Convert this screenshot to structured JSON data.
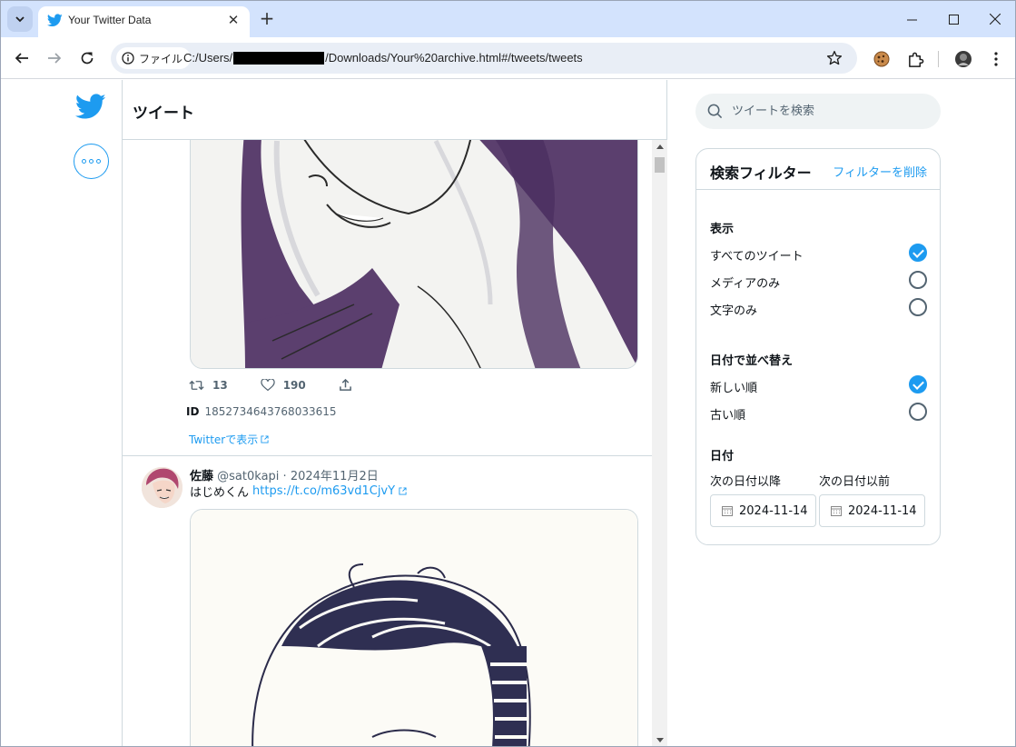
{
  "browser": {
    "tab_title": "Your Twitter Data",
    "chip_label": "ファイル",
    "url_prefix": "C:/Users/",
    "url_suffix": "/Downloads/Your%20archive.html#/tweets/tweets"
  },
  "main": {
    "title": "ツイート"
  },
  "tweet1": {
    "retweets": "13",
    "likes": "190",
    "id_label": "ID",
    "id_value": "1852734643768033615",
    "view_link": "Twitterで表示"
  },
  "tweet2": {
    "name": "佐藤",
    "handle": "@sat0kapi",
    "separator": "·",
    "date": "2024年11月2日",
    "text": "はじめくん",
    "link": "https://t.co/m63vd1CjvY"
  },
  "sidebar": {
    "search_placeholder": "ツイートを検索",
    "filter_title": "検索フィルター",
    "clear_filters": "フィルターを削除",
    "display_heading": "表示",
    "display_options": [
      "すべてのツイート",
      "メディアのみ",
      "文字のみ"
    ],
    "display_selected": "すべてのツイート",
    "sort_heading": "日付で並べ替え",
    "sort_options": [
      "新しい順",
      "古い順"
    ],
    "sort_selected": "新しい順",
    "date_heading": "日付",
    "date_from_label": "次の日付以降",
    "date_to_label": "次の日付以前",
    "date_from": "2024-11-14",
    "date_to": "2024-11-14"
  },
  "colors": {
    "accent": "#1d9bf0",
    "tab_bar": "#d3e3fd"
  }
}
